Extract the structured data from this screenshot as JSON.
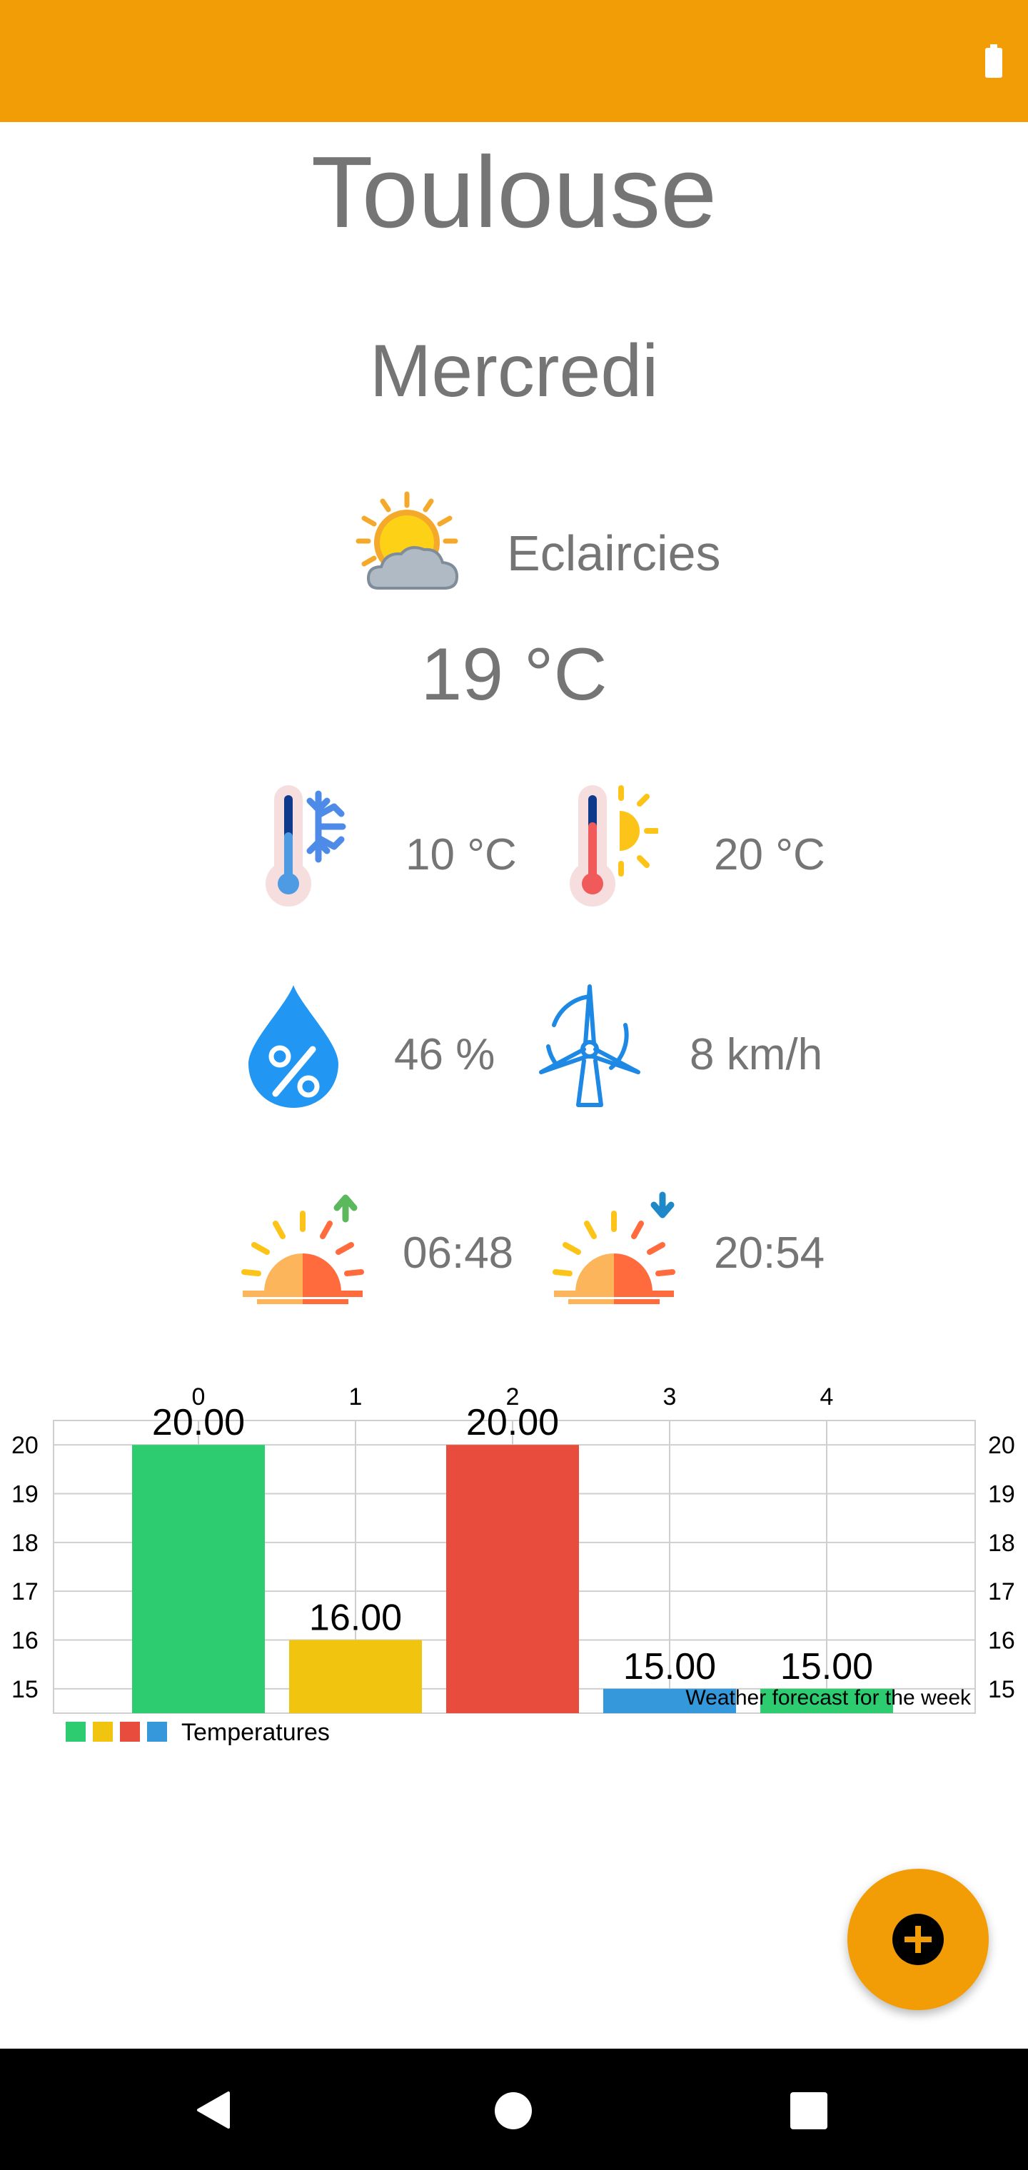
{
  "city": "Toulouse",
  "day": "Mercredi",
  "condition": {
    "icon": "sun-behind-cloud-icon",
    "text": "Eclaircies"
  },
  "temperature": "19 °C",
  "stats": {
    "temp_min": "10 °C",
    "temp_max": "20 °C",
    "humidity": "46 %",
    "wind": "8 km/h",
    "sunrise": "06:48",
    "sunset": "20:54"
  },
  "colors": {
    "accent": "#F29D05",
    "text": "#757575",
    "green": "#2ECC71",
    "yellow": "#F1C40F",
    "red": "#E74C3C",
    "blue": "#3498DB"
  },
  "chart_data": {
    "type": "bar",
    "categories": [
      "0",
      "1",
      "2",
      "3",
      "4"
    ],
    "values": [
      20,
      16,
      20,
      15,
      15
    ],
    "value_labels": [
      "20.00",
      "16.00",
      "20.00",
      "15.00",
      "15.00"
    ],
    "bar_colors": [
      "#2ECC71",
      "#F1C40F",
      "#E74C3C",
      "#3498DB",
      "#2ECC71"
    ],
    "y_ticks": [
      "15",
      "16",
      "17",
      "18",
      "19",
      "20"
    ],
    "ylim": [
      14.5,
      20.5
    ],
    "grid": true,
    "legend": {
      "label": "Temperatures",
      "placement": "bottom-left",
      "colors": [
        "#2ECC71",
        "#F1C40F",
        "#E74C3C",
        "#3498DB"
      ]
    },
    "description": "Weather forecast for the week"
  }
}
